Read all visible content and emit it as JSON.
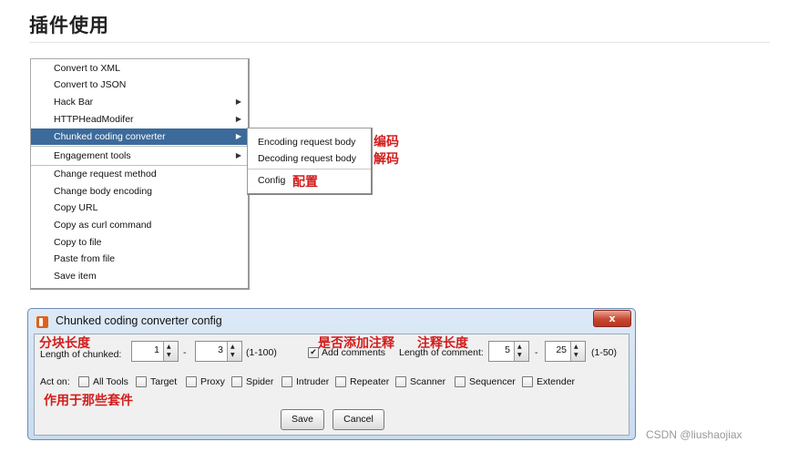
{
  "article": {
    "heading": "插件使用",
    "watermark": "CSDN @liushaojiax"
  },
  "context_menu": {
    "items": [
      {
        "label": "Convert to XML",
        "has_submenu": false
      },
      {
        "label": "Convert to JSON",
        "has_submenu": false
      },
      {
        "label": "Hack Bar",
        "has_submenu": true
      },
      {
        "label": "HTTPHeadModifer",
        "has_submenu": true
      },
      {
        "label": "Chunked coding converter",
        "has_submenu": true,
        "selected": true
      },
      {
        "label": "Engagement tools",
        "has_submenu": true
      },
      {
        "label": "Change request method",
        "has_submenu": false
      },
      {
        "label": "Change body encoding",
        "has_submenu": false
      },
      {
        "label": "Copy URL",
        "has_submenu": false
      },
      {
        "label": "Copy as curl command",
        "has_submenu": false
      },
      {
        "label": "Copy to file",
        "has_submenu": false
      },
      {
        "label": "Paste from file",
        "has_submenu": false
      },
      {
        "label": "Save item",
        "has_submenu": false
      }
    ],
    "submenu_arrow": "▶"
  },
  "submenu": {
    "items": [
      {
        "label": "Encoding request body"
      },
      {
        "label": "Decoding request body"
      },
      {
        "label": "Config"
      }
    ]
  },
  "annotations": {
    "encode": "编码",
    "decode": "解码",
    "config": "配置",
    "chunk_length": "分块长度",
    "add_comments": "是否添加注释",
    "comment_length": "注释长度",
    "act_on": "作用于那些套件"
  },
  "dialog": {
    "title": "Chunked coding converter config",
    "close_label": "x",
    "chunk_label": "Length of chunked:",
    "chunk_min": "1",
    "chunk_max": "3",
    "chunk_range": "(1-100)",
    "dash": "-",
    "add_comments_label": "Add comments",
    "add_comments_checked": true,
    "check_mark": "✔",
    "comment_label": "Length of comment:",
    "comment_min": "5",
    "comment_max": "25",
    "comment_range": "(1-50)",
    "act_on_label": "Act on:",
    "tools": [
      "All Tools",
      "Target",
      "Proxy",
      "Spider",
      "Intruder",
      "Repeater",
      "Scanner",
      "Sequencer",
      "Extender"
    ],
    "save_label": "Save",
    "cancel_label": "Cancel",
    "spin_up": "▲",
    "spin_down": "▼"
  }
}
